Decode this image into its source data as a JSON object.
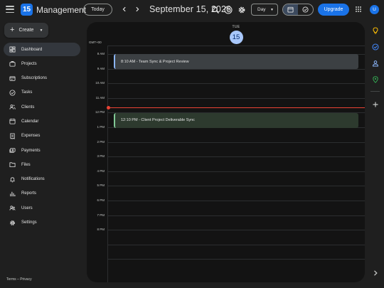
{
  "header": {
    "logo_text": "15",
    "app_title": "Management",
    "today_label": "Today",
    "prev_icon": "chevron-left-icon",
    "next_icon": "chevron-right-icon",
    "date_title": "September 15, 2026",
    "view_label": "Day",
    "upgrade_label": "Upgrade",
    "avatar_initial": "U"
  },
  "sidebar": {
    "create_label": "Create",
    "items": [
      {
        "label": "Dashboard",
        "icon": "dashboard-icon"
      },
      {
        "label": "Projects",
        "icon": "briefcase-icon"
      },
      {
        "label": "Subscriptions",
        "icon": "subscription-icon"
      },
      {
        "label": "Tasks",
        "icon": "check-circle-icon"
      },
      {
        "label": "Clients",
        "icon": "people-icon"
      },
      {
        "label": "Calendar",
        "icon": "calendar-icon"
      },
      {
        "label": "Expenses",
        "icon": "receipt-icon"
      },
      {
        "label": "Payments",
        "icon": "payments-icon"
      },
      {
        "label": "Files",
        "icon": "folder-icon"
      },
      {
        "label": "Notifications",
        "icon": "bell-icon"
      },
      {
        "label": "Reports",
        "icon": "bar-chart-icon"
      },
      {
        "label": "Users",
        "icon": "users-icon"
      },
      {
        "label": "Settings",
        "icon": "gear-icon"
      }
    ],
    "footer": {
      "terms": "Terms",
      "separator": " – ",
      "privacy": "Privacy"
    }
  },
  "calendar": {
    "day_name": "TUE",
    "day_number": "15",
    "timezone": "GMT+00",
    "hours": [
      "8 AM",
      "9 AM",
      "10 AM",
      "11 AM",
      "12 PM",
      "1 PM",
      "2 PM",
      "3 PM",
      "4 PM",
      "5 PM",
      "6 PM",
      "7 PM",
      "8 PM"
    ],
    "events": [
      {
        "label": "8:10 AM - Team Sync & Project Review",
        "color": "#3c4043",
        "accent": "#8ab4f8"
      },
      {
        "label": "12:10 PM - Client Project Deliverable Sync",
        "color": "#2d3a2e",
        "accent": "#81c995"
      }
    ],
    "now_line_color": "#ea4335"
  },
  "colors": {
    "background": "#1f1f1f",
    "panel": "#131313",
    "primary": "#1a73e8",
    "today_circle": "#a8c7fa"
  },
  "rail": {
    "icons": [
      "keep-icon",
      "tasks-icon",
      "contacts-icon",
      "maps-icon",
      "add-icon",
      "expand-icon"
    ]
  }
}
